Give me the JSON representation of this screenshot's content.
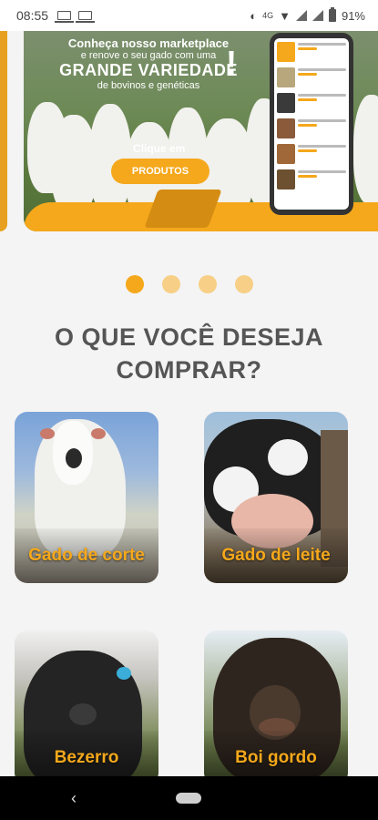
{
  "status_bar": {
    "time": "08:55",
    "battery": "91%",
    "network": "4G"
  },
  "banner": {
    "line1": "Conheça nosso marketplace",
    "line2": "e renove o seu gado com uma",
    "line3": "GRANDE VARIEDADE",
    "line4": "de bovinos e genéticas",
    "exclaim": "!",
    "cta_text": "Clique em",
    "cta_button": "PRODUTOS"
  },
  "carousel": {
    "total": 4,
    "active": 1
  },
  "section": {
    "title": "O QUE VOCÊ DESEJA COMPRAR?"
  },
  "categories": [
    {
      "label": "Gado de corte"
    },
    {
      "label": "Gado de leite"
    },
    {
      "label": "Bezerro"
    },
    {
      "label": "Boi gordo"
    }
  ],
  "colors": {
    "accent": "#f5a81b",
    "accent_light": "#f7cf86",
    "title": "#555555"
  }
}
